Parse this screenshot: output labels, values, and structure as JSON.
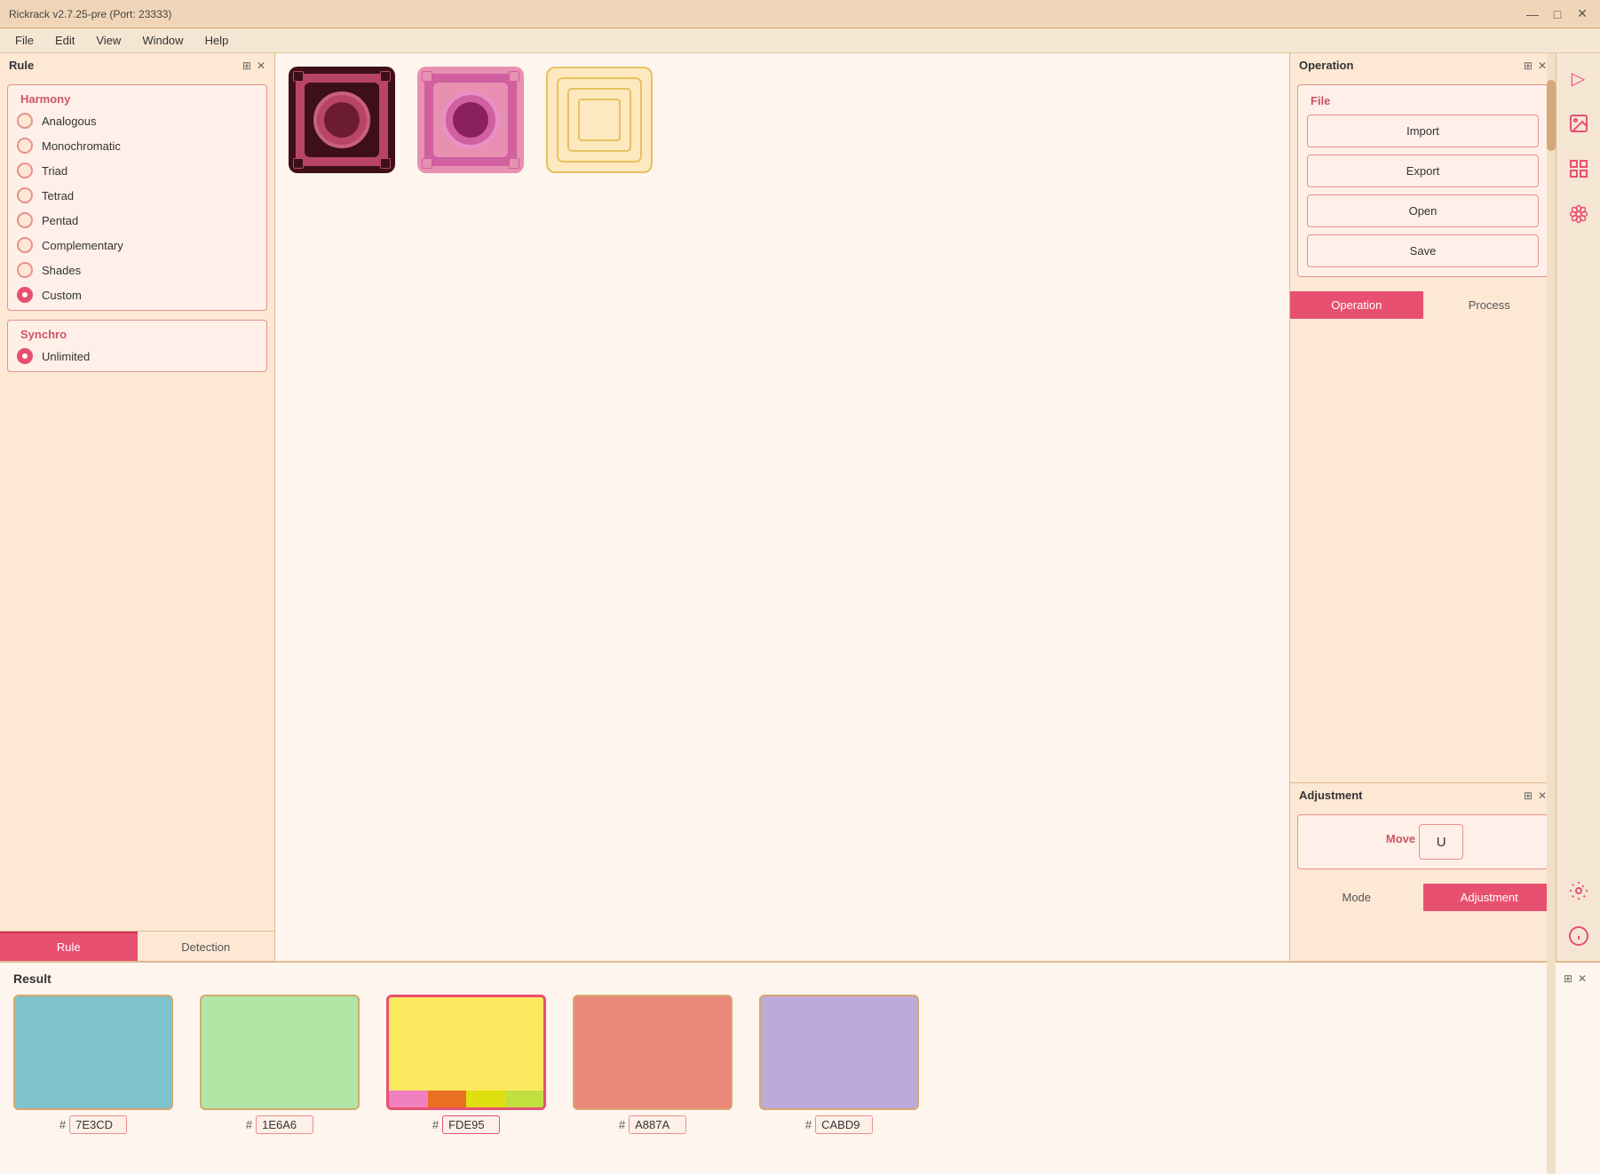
{
  "app": {
    "title": "Rickrack v2.7.25-pre (Port: 23333)",
    "title_bar_minimize": "—",
    "title_bar_maximize": "□",
    "title_bar_close": "✕"
  },
  "menu": {
    "items": [
      "File",
      "Edit",
      "View",
      "Window",
      "Help"
    ]
  },
  "rule_panel": {
    "title": "Rule",
    "harmony_section": {
      "label": "Harmony",
      "options": [
        {
          "id": "analogous",
          "label": "Analogous",
          "selected": false
        },
        {
          "id": "monochromatic",
          "label": "Monochromatic",
          "selected": false
        },
        {
          "id": "triad",
          "label": "Triad",
          "selected": false
        },
        {
          "id": "tetrad",
          "label": "Tetrad",
          "selected": false
        },
        {
          "id": "pentad",
          "label": "Pentad",
          "selected": false
        },
        {
          "id": "complementary",
          "label": "Complementary",
          "selected": false
        },
        {
          "id": "shades",
          "label": "Shades",
          "selected": false
        },
        {
          "id": "custom",
          "label": "Custom",
          "selected": true
        }
      ]
    },
    "synchro_section": {
      "label": "Synchro",
      "options": [
        {
          "id": "unlimited",
          "label": "Unlimited",
          "selected": true
        }
      ]
    },
    "tabs": [
      {
        "id": "rule",
        "label": "Rule",
        "active": true
      },
      {
        "id": "detection",
        "label": "Detection",
        "active": false
      }
    ]
  },
  "operation_panel": {
    "title": "Operation",
    "file_section_label": "File",
    "buttons": [
      "Import",
      "Export",
      "Open",
      "Save"
    ],
    "tabs": [
      {
        "id": "operation",
        "label": "Operation",
        "active": true
      },
      {
        "id": "process",
        "label": "Process",
        "active": false
      }
    ]
  },
  "adjustment_panel": {
    "title": "Adjustment",
    "move_section_label": "Move",
    "move_btn": "U",
    "tabs": [
      {
        "id": "mode",
        "label": "Mode",
        "active": false
      },
      {
        "id": "adjustment",
        "label": "Adjustment",
        "active": true
      }
    ]
  },
  "result_panel": {
    "title": "Result",
    "colors": [
      {
        "hex": "7E3CD",
        "color": "#7EC3CD",
        "selected": false
      },
      {
        "hex": "1E6A6",
        "color": "#B1E6A6",
        "selected": false
      },
      {
        "hex": "FDE95",
        "color": "#FDE95F",
        "selected": true,
        "multi": true,
        "strips": [
          "#f080c0",
          "#e87020",
          "#e0e010",
          "#c0e040"
        ]
      },
      {
        "hex": "A887A",
        "color": "#EA887A",
        "selected": false
      },
      {
        "hex": "CABD9",
        "color": "#BCABD9",
        "selected": false
      }
    ]
  },
  "right_sidebar_icons": [
    {
      "name": "triangle-icon",
      "glyph": "▷"
    },
    {
      "name": "image-icon",
      "glyph": "🖼"
    },
    {
      "name": "grid-icon",
      "glyph": "⊞"
    },
    {
      "name": "flower-icon",
      "glyph": "❀"
    },
    {
      "name": "gear-icon",
      "glyph": "⚙"
    },
    {
      "name": "info-icon",
      "glyph": "ℹ"
    }
  ],
  "center_swatches": [
    {
      "type": "maroon",
      "colors": {
        "bg": "#4a1520",
        "layer": "#b84468",
        "center": "#6b1c30"
      }
    },
    {
      "type": "pink",
      "colors": {
        "bg": "#e890b0",
        "layer": "#d060a0",
        "center": "#8a2060"
      }
    },
    {
      "type": "outline",
      "colors": {
        "bg": "#fde8c0",
        "border": "#e8c060"
      }
    }
  ]
}
